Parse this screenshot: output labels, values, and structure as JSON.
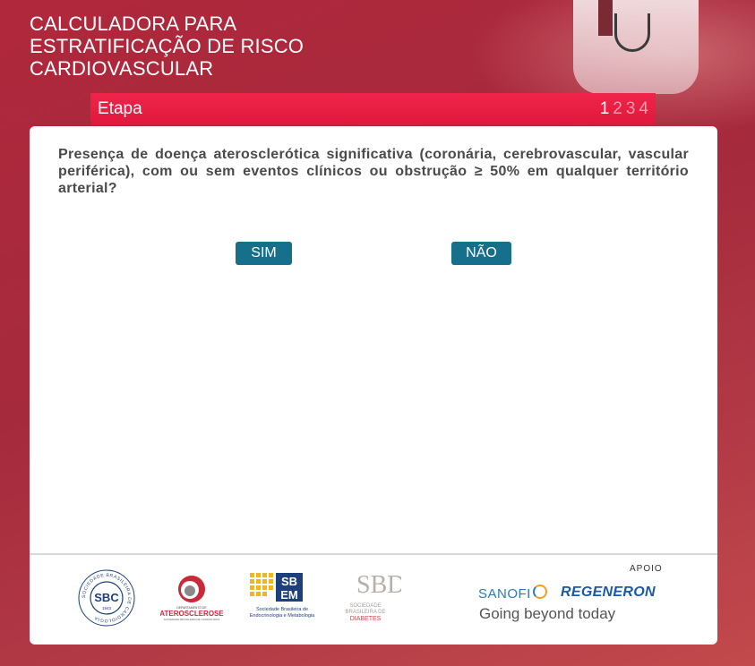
{
  "header": {
    "title_lines": [
      "CALCULADORA PARA",
      "ESTRATIFICAÇÃO DE RISCO",
      "CARDIOVASCULAR"
    ]
  },
  "etapa": {
    "label": "Etapa",
    "steps": [
      "1",
      "2",
      "3",
      "4"
    ],
    "current": "1"
  },
  "question": {
    "text": "Presença de doença aterosclerótica significativa (coronária, cerebrovascular, vascular periférica), com ou sem eventos clínicos ou obstrução ≥ 50% em qualquer território arterial?"
  },
  "answers": {
    "yes_label": "SIM",
    "no_label": "NÃO"
  },
  "footer": {
    "sbc": {
      "abbr": "SBC",
      "ring_text": "SOCIEDADE BRASILEIRA DE CARDIOLOGIA",
      "year": "1943"
    },
    "aterosclerose": {
      "dept": "DEPARTAMENTO DE",
      "name": "ATEROSCLEROSE",
      "sub": "SOCIEDADE BRASILEIRA DE CARDIOLOGIA"
    },
    "sbem": {
      "abbr_top": "SB",
      "abbr_bottom": "EM",
      "line1": "Sociedade Brasileira de",
      "line2": "Endocrinologia e Metabologia"
    },
    "sbd": {
      "letters": "SBD",
      "line1": "SOCIEDADE",
      "line2": "BRASILEIRA DE",
      "line3": "DIABETES"
    },
    "apoio_label": "APOIO",
    "sponsor1": "SANOFI",
    "sponsor2": "REGENERON",
    "tagline": "Going beyond today"
  },
  "colors": {
    "background": "#a52a3c",
    "etapa_bar": "#e81c42",
    "button": "#16708c",
    "card": "#ffffff"
  }
}
